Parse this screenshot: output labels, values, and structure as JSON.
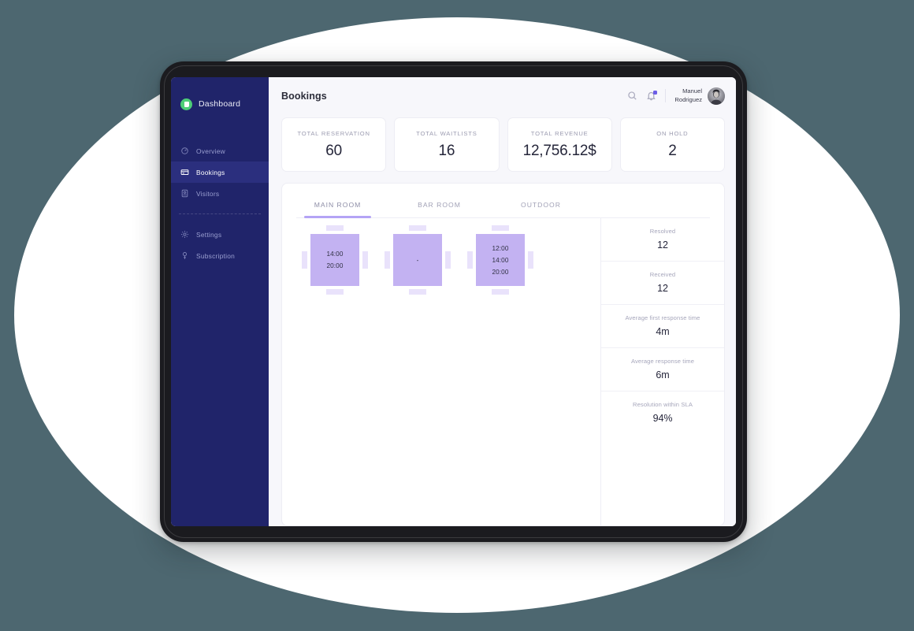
{
  "sidebar": {
    "brand": {
      "name": "Dashboard",
      "logo_icon": "app-logo-icon",
      "logo_color": "#4dcd77"
    },
    "items": [
      {
        "label": "Overview",
        "icon": "overview-icon",
        "active": false
      },
      {
        "label": "Bookings",
        "icon": "bookings-icon",
        "active": true
      },
      {
        "label": "Visitors",
        "icon": "visitors-icon",
        "active": false
      },
      {
        "label": "Settings",
        "icon": "settings-gear-icon",
        "active": false
      },
      {
        "label": "Subscription",
        "icon": "subscription-icon",
        "active": false
      }
    ],
    "bg_color": "#20246a",
    "active_color": "#2b2f7e"
  },
  "topbar": {
    "title": "Bookings",
    "search_icon": "search-icon",
    "notification_icon": "bell-icon",
    "notification_badge_color": "#6c5ce7",
    "user": {
      "name": "Manuel\nRodriguez",
      "avatar_icon": "user-avatar"
    }
  },
  "stats": [
    {
      "label": "TOTAL RESERVATION",
      "value": "60"
    },
    {
      "label": "TOTAL WAITLISTS",
      "value": "16"
    },
    {
      "label": "TOTAL REVENUE",
      "value": "12,756.12$"
    },
    {
      "label": "ON HOLD",
      "value": "2"
    }
  ],
  "tabs": [
    {
      "label": "MAIN ROOM",
      "active": true
    },
    {
      "label": "BAR ROOM",
      "active": false
    },
    {
      "label": "OUTDOOR",
      "active": false
    }
  ],
  "tab_accent_color": "#b4a3f5",
  "floor_plan": {
    "table_color": "#c3b2f2",
    "chair_color": "#e9e2fb",
    "tables": [
      {
        "name": "table-1",
        "slots": [
          "14:00",
          "20:00"
        ]
      },
      {
        "name": "table-2",
        "slots": [
          "-"
        ]
      },
      {
        "name": "table-3",
        "slots": [
          "12:00",
          "14:00",
          "20:00"
        ]
      }
    ]
  },
  "side_stats": [
    {
      "label": "Resolved",
      "value": "12"
    },
    {
      "label": "Received",
      "value": "12"
    },
    {
      "label": "Average first response time",
      "value": "4m"
    },
    {
      "label": "Average response time",
      "value": "6m"
    },
    {
      "label": "Resolution within SLA",
      "value": "94%"
    }
  ],
  "background": {
    "page_color": "#4d6770",
    "ellipse_color": "#ffffff",
    "device_color": "#1b1b1f"
  }
}
